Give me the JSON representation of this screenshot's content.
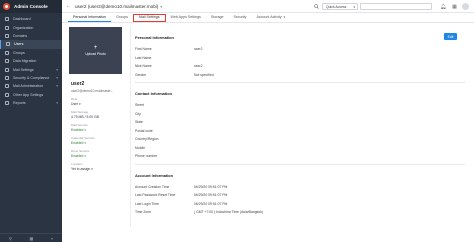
{
  "app": {
    "title": "Admin Console"
  },
  "sidebar": {
    "items": [
      {
        "label": "Dashboard",
        "icon": "dashboard-icon",
        "active": false,
        "expandable": false
      },
      {
        "label": "Organization",
        "icon": "building-icon",
        "active": false,
        "expandable": false
      },
      {
        "label": "Domains",
        "icon": "globe-icon",
        "active": false,
        "expandable": false
      },
      {
        "label": "Users",
        "icon": "user-icon",
        "active": true,
        "expandable": false
      },
      {
        "label": "Groups",
        "icon": "group-icon",
        "active": false,
        "expandable": false
      },
      {
        "label": "Data Migration",
        "icon": "migration-icon",
        "active": false,
        "expandable": false
      },
      {
        "label": "Mail Settings",
        "icon": "mail-icon",
        "active": false,
        "expandable": true
      },
      {
        "label": "Security & Compliance",
        "icon": "shield-icon",
        "active": false,
        "expandable": true
      },
      {
        "label": "Mail Administration",
        "icon": "mail-admin-icon",
        "active": false,
        "expandable": true
      },
      {
        "label": "Other App Settings",
        "icon": "apps-icon",
        "active": false,
        "expandable": false
      },
      {
        "label": "Reports",
        "icon": "chart-icon",
        "active": false,
        "expandable": true
      }
    ]
  },
  "topbar": {
    "back_icon": "back-arrow-icon",
    "user_title": "user2 (user2@demo10.mailmaster.mobi)",
    "quick_access": "Quick Access",
    "search_placeholder": ""
  },
  "tabs": [
    {
      "label": "Personal Information",
      "active": true,
      "highlight": false,
      "dropdown": false
    },
    {
      "label": "Groups",
      "active": false,
      "highlight": false,
      "dropdown": false
    },
    {
      "label": "Mail Settings",
      "active": false,
      "highlight": true,
      "dropdown": false
    },
    {
      "label": "Web Apps Settings",
      "active": false,
      "highlight": false,
      "dropdown": false
    },
    {
      "label": "Storage",
      "active": false,
      "highlight": false,
      "dropdown": false
    },
    {
      "label": "Security",
      "active": false,
      "highlight": false,
      "dropdown": false
    },
    {
      "label": "Account Activity",
      "active": false,
      "highlight": false,
      "dropdown": true
    }
  ],
  "profile": {
    "upload_label": "Upload Photo",
    "name": "user2",
    "email": "user2@demo10.mailmaste...",
    "role_label": "Role",
    "role_value": "User",
    "storage_label": "Mail Storage",
    "storage_value": "4.75 MB / 5.00 GB",
    "mail_service_label": "Mail Service",
    "mail_service_value": "Enabled",
    "calendar_label": "Calendar Service",
    "calendar_value": "Enabled",
    "drive_label": "Drive Service",
    "drive_value": "Enabled",
    "location_label": "Location",
    "location_value": "Yet to assign"
  },
  "main": {
    "edit_label": "Edit",
    "personal": {
      "title": "Personal Information",
      "rows": [
        {
          "k": "First Name",
          "v": "user2"
        },
        {
          "k": "Last Name",
          "v": ""
        },
        {
          "k": "Nick Name",
          "v": "user2"
        },
        {
          "k": "Gender",
          "v": "Not specified"
        }
      ]
    },
    "contact": {
      "title": "Contact Information",
      "rows": [
        {
          "k": "Street",
          "v": ""
        },
        {
          "k": "City",
          "v": ""
        },
        {
          "k": "State",
          "v": ""
        },
        {
          "k": "Postal code",
          "v": ""
        },
        {
          "k": "Country/Region",
          "v": ""
        },
        {
          "k": "Mobile",
          "v": ""
        },
        {
          "k": "Phone number",
          "v": ""
        }
      ]
    },
    "account": {
      "title": "Account Information",
      "rows": [
        {
          "k": "Account Creation Time",
          "v": "06/29/20 09:51:07 PM"
        },
        {
          "k": "Last Password Reset Time",
          "v": "06/29/20 09:51:07 PM"
        },
        {
          "k": "Last Login Time",
          "v": "06/29/20 09:51:07 PM"
        },
        {
          "k": "Time Zone",
          "v": "( GMT +7:00 ) Indochina Time (Asia/Bangkok)"
        }
      ]
    }
  }
}
